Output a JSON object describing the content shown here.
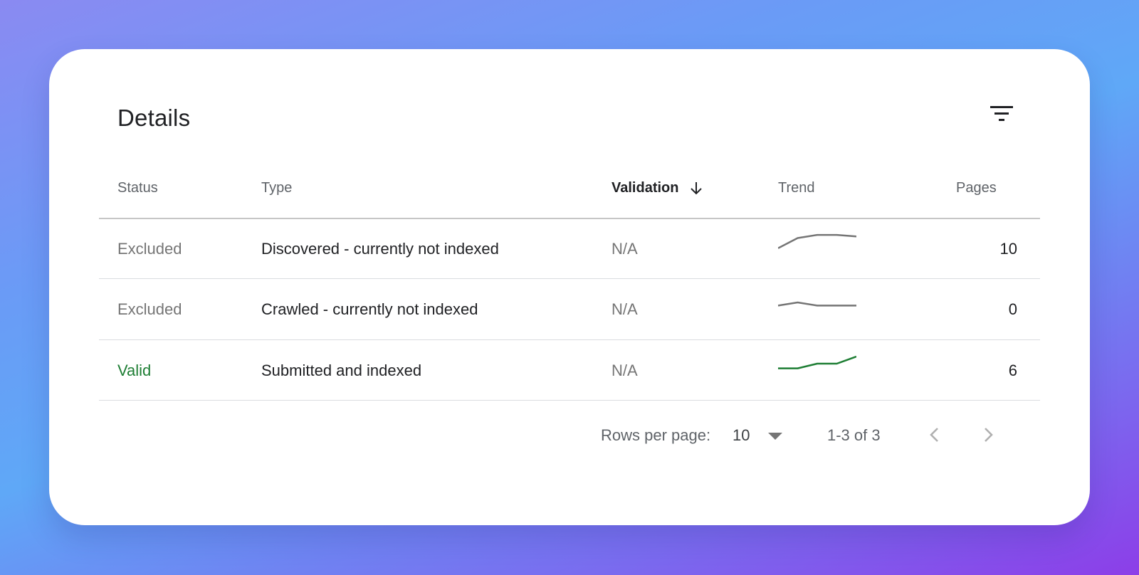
{
  "details": {
    "title": "Details",
    "filter_icon": "filter-icon"
  },
  "table": {
    "columns": {
      "status": "Status",
      "type": "Type",
      "validation": "Validation",
      "trend": "Trend",
      "pages": "Pages"
    },
    "sort_icon": "arrow-down-icon",
    "rows": [
      {
        "status": "Excluded",
        "type": "Discovered - currently not indexed",
        "validation": "N/A",
        "trend_color": "#757575",
        "trend": [
          0.1,
          0.75,
          0.95,
          0.95,
          0.85
        ],
        "pages": "10"
      },
      {
        "status": "Excluded",
        "type": "Crawled - currently not indexed",
        "validation": "N/A",
        "trend_color": "#757575",
        "trend": [
          0.3,
          0.5,
          0.3,
          0.3,
          0.3
        ],
        "pages": "0"
      },
      {
        "status": "Valid",
        "type": "Submitted and indexed",
        "validation": "N/A",
        "trend_color": "#1e7e34",
        "trend": [
          0.2,
          0.2,
          0.5,
          0.5,
          0.95
        ],
        "pages": "6"
      }
    ]
  },
  "pagination": {
    "rows_per_page_label": "Rows per page:",
    "rows_per_page_value": "10",
    "range_text": "1-3 of 3",
    "prev_icon": "chevron-left-icon",
    "next_icon": "chevron-right-icon"
  },
  "colors": {
    "valid": "#1e7e34",
    "excluded": "#757575"
  }
}
